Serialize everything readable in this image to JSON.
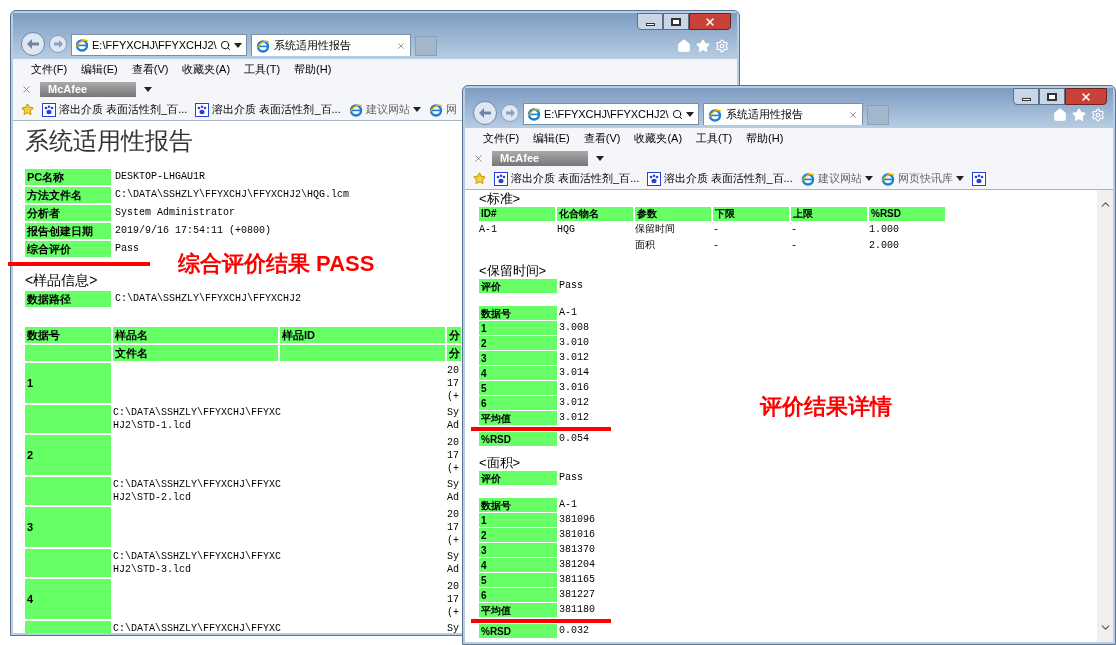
{
  "annotations": [
    {
      "text": "综合评价结果 PASS"
    },
    {
      "text": "评价结果详情"
    }
  ],
  "windows": [
    {
      "address": "E:\\FFYXCHJ\\FFYXCHJ2\\",
      "tab_title": "系统适用性报告",
      "menu": [
        "文件(F)",
        "编辑(E)",
        "查看(V)",
        "收藏夹(A)",
        "工具(T)",
        "帮助(H)"
      ],
      "toolbar_label": "McAfee",
      "favorites": [
        {
          "kind": "baidu",
          "label": "溶出介质 表面活性剂_百...",
          "dropdown": false
        },
        {
          "kind": "baidu",
          "label": "溶出介质 表面活性剂_百...",
          "dropdown": false
        },
        {
          "kind": "ie",
          "label": "建议网站",
          "dropdown": true
        },
        {
          "kind": "ie",
          "label": "网",
          "dropdown": false
        }
      ],
      "report": {
        "title": "系统适用性报告",
        "summary": [
          {
            "label": "PC名称",
            "value": "DESKTOP-LHGAU1R"
          },
          {
            "label": "方法文件名",
            "value": "C:\\DATA\\SSHZLY\\FFYXCHJ\\FFYXCHJ2\\HQG.lcm"
          },
          {
            "label": "分析者",
            "value": "System Administrator"
          },
          {
            "label": "报告创建日期",
            "value": "2019/9/16 17:54:11 (+0800)"
          },
          {
            "label": "综合评价",
            "value": "Pass"
          }
        ],
        "sample_heading": "<样品信息>",
        "data_path": {
          "label": "数据路径",
          "value": "C:\\DATA\\SSHZLY\\FFYXCHJ\\FFYXCHJ2"
        },
        "sample_table": {
          "columns": [
            {
              "label": "数据号"
            },
            {
              "label": "样品名",
              "sub": "文件名"
            },
            {
              "label": "样品ID"
            },
            {
              "label": "分",
              "sub": "分"
            }
          ],
          "rows": [
            {
              "number": "1",
              "col4": [
                "20",
                "17",
                "(+"
              ],
              "file": [
                "C:\\DATA\\SSHZLY\\FFYXCHJ\\FFYXC",
                "HJ2\\STD-1.lcd"
              ],
              "col4_sub": [
                "Sy",
                "Ad"
              ]
            },
            {
              "number": "2",
              "col4": [
                "20",
                "17",
                "(+"
              ],
              "file": [
                "C:\\DATA\\SSHZLY\\FFYXCHJ\\FFYXC",
                "HJ2\\STD-2.lcd"
              ],
              "col4_sub": [
                "Sy",
                "Ad"
              ]
            },
            {
              "number": "3",
              "col4": [
                "20",
                "17",
                "(+"
              ],
              "file": [
                "C:\\DATA\\SSHZLY\\FFYXCHJ\\FFYXC",
                "HJ2\\STD-3.lcd"
              ],
              "col4_sub": [
                "Sy",
                "Ad"
              ]
            },
            {
              "number": "4",
              "col4": [
                "20",
                "17",
                "(+"
              ],
              "file": [
                "C:\\DATA\\SSHZLY\\FFYXCHJ\\FFYXC"
              ],
              "col4_sub": [
                "Sy"
              ]
            }
          ]
        }
      }
    },
    {
      "address": "E:\\FFYXCHJ\\FFYXCHJ2\\",
      "tab_title": "系统适用性报告",
      "menu": [
        "文件(F)",
        "编辑(E)",
        "查看(V)",
        "收藏夹(A)",
        "工具(T)",
        "帮助(H)"
      ],
      "toolbar_label": "McAfee",
      "favorites": [
        {
          "kind": "baidu",
          "label": "溶出介质 表面活性剂_百...",
          "dropdown": false
        },
        {
          "kind": "baidu",
          "label": "溶出介质 表面活性剂_百...",
          "dropdown": false
        },
        {
          "kind": "ie",
          "label": "建议网站",
          "dropdown": true
        },
        {
          "kind": "ie",
          "label": "网页快讯库",
          "dropdown": true
        },
        {
          "kind": "baidu",
          "dropdown": false
        }
      ],
      "report": {
        "standard": {
          "heading": "<标准>",
          "columns": [
            "ID#",
            "化合物名",
            "参数",
            "下限",
            "上限",
            "%RSD"
          ],
          "rows": [
            [
              "A-1",
              "HQG",
              "保留时间",
              "-",
              "-",
              "1.000"
            ],
            [
              null,
              null,
              "面积",
              "-",
              "-",
              "2.000"
            ]
          ]
        },
        "results": [
          {
            "heading": "<保留时间>",
            "evaluation": {
              "label": "评价",
              "value": "Pass"
            },
            "header": {
              "label": "数据号",
              "value": "A-1"
            },
            "rows": [
              {
                "label": "1",
                "value": "3.008"
              },
              {
                "label": "2",
                "value": "3.010"
              },
              {
                "label": "3",
                "value": "3.012"
              },
              {
                "label": "4",
                "value": "3.014"
              },
              {
                "label": "5",
                "value": "3.016"
              },
              {
                "label": "6",
                "value": "3.012"
              },
              {
                "label": "平均值",
                "value": "3.012"
              }
            ],
            "rsd": {
              "label": "%RSD",
              "value": "0.054"
            }
          },
          {
            "heading": "<面积>",
            "evaluation": {
              "label": "评价",
              "value": "Pass"
            },
            "header": {
              "label": "数据号",
              "value": "A-1"
            },
            "rows": [
              {
                "label": "1",
                "value": "381096"
              },
              {
                "label": "2",
                "value": "381016"
              },
              {
                "label": "3",
                "value": "381370"
              },
              {
                "label": "4",
                "value": "381204"
              },
              {
                "label": "5",
                "value": "381165"
              },
              {
                "label": "6",
                "value": "381227"
              },
              {
                "label": "平均值",
                "value": "381180"
              }
            ],
            "rsd": {
              "label": "%RSD",
              "value": "0.032"
            }
          }
        ]
      }
    }
  ]
}
